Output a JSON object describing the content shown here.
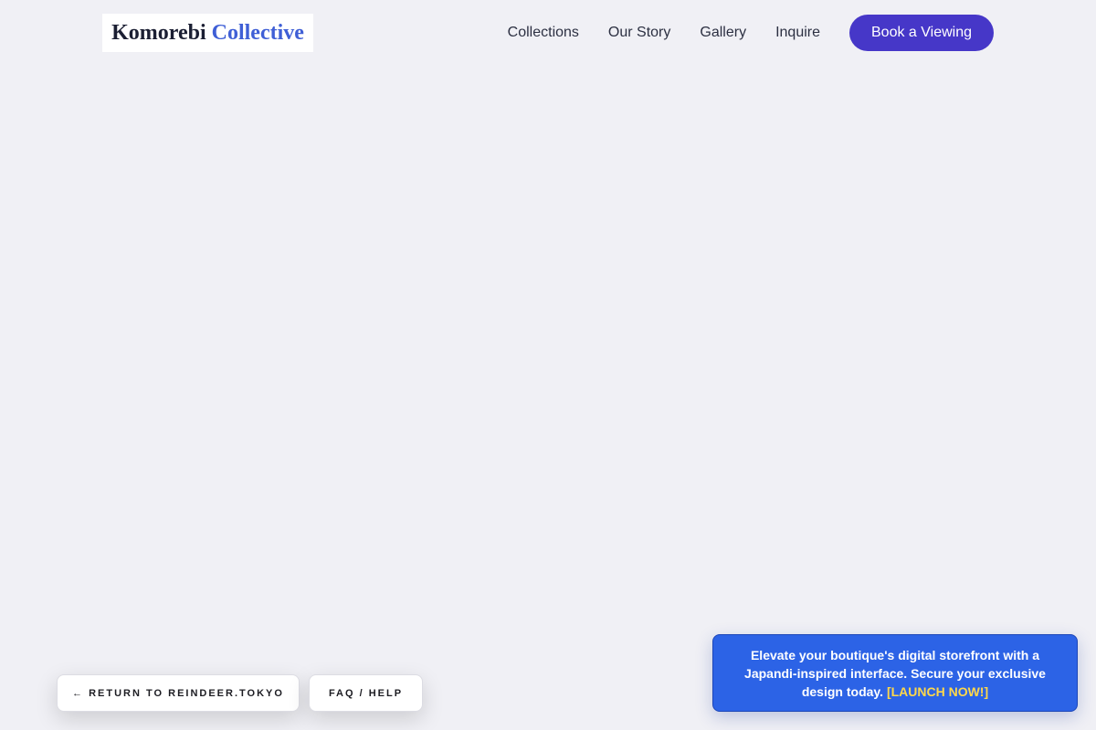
{
  "header": {
    "logo": {
      "word1": "Komorebi",
      "word2": "Collective"
    },
    "nav": [
      {
        "label": "Collections"
      },
      {
        "label": "Our Story"
      },
      {
        "label": "Gallery"
      },
      {
        "label": "Inquire"
      }
    ],
    "cta_label": "Book a Viewing"
  },
  "footer_buttons": {
    "return_label": "← RETURN TO REINDEER.TOKYO",
    "faq_label": "FAQ / HELP"
  },
  "promo": {
    "text": "Elevate your boutique's digital storefront with a Japandi-inspired interface. Secure your exclusive design today.",
    "link_label": "[LAUNCH NOW!]"
  },
  "colors": {
    "background": "#f0f0f5",
    "brand_accent": "#3f5fd6",
    "cta_background": "#4637c8",
    "promo_background": "#2c63e6",
    "promo_link": "#ffd84a"
  }
}
